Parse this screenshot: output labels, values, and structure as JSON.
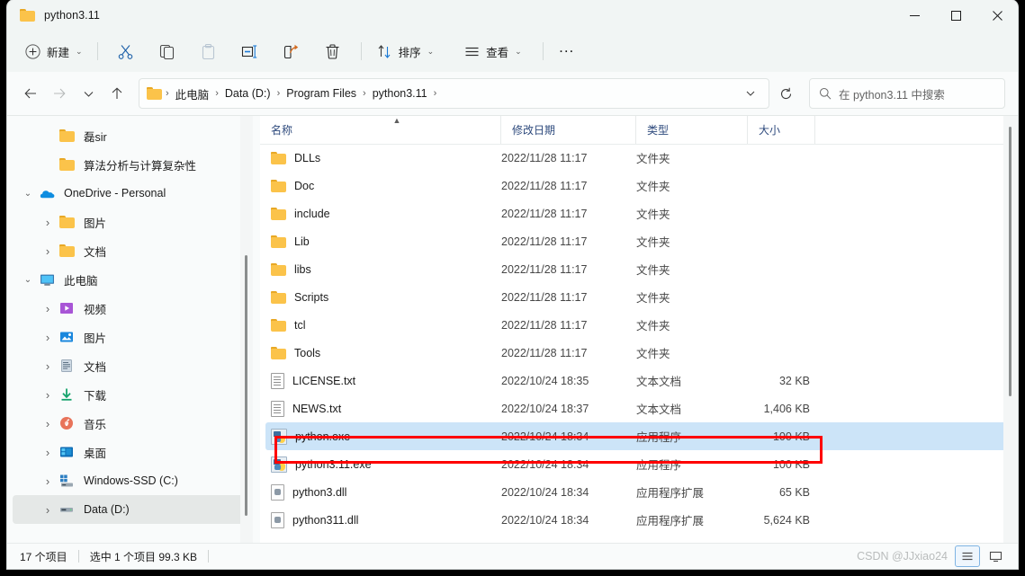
{
  "window": {
    "title": "python3.11",
    "minimize_label": "最小化",
    "maximize_label": "最大化",
    "close_label": "关闭"
  },
  "toolbar": {
    "new_label": "新建",
    "cut_label": "剪切",
    "copy_label": "复制",
    "paste_label": "粘贴",
    "rename_label": "重命名",
    "share_label": "共享",
    "delete_label": "删除",
    "sort_label": "排序",
    "view_label": "查看",
    "more_label": "..."
  },
  "address": {
    "back_label": "后退",
    "forward_label": "前进",
    "recent_label": "最近位置",
    "up_label": "上移到",
    "crumbs": [
      "此电脑",
      "Data (D:)",
      "Program Files",
      "python3.11"
    ],
    "separator": "›",
    "refresh_label": "刷新",
    "search_placeholder": "在 python3.11 中搜索"
  },
  "sidebar": {
    "items": [
      {
        "label": "磊sir",
        "icon": "folder",
        "expander": "none",
        "indent": 2
      },
      {
        "label": "算法分析与计算复杂性",
        "icon": "folder",
        "expander": "none",
        "indent": 2
      },
      {
        "label": "OneDrive - Personal",
        "icon": "onedrive",
        "expander": "expanded",
        "indent": 0
      },
      {
        "label": "图片",
        "icon": "folder",
        "expander": "collapsed",
        "indent": 1
      },
      {
        "label": "文档",
        "icon": "folder",
        "expander": "collapsed",
        "indent": 1
      },
      {
        "label": "此电脑",
        "icon": "pc",
        "expander": "expanded",
        "indent": 0
      },
      {
        "label": "视频",
        "icon": "video",
        "expander": "collapsed",
        "indent": 1
      },
      {
        "label": "图片",
        "icon": "pictures",
        "expander": "collapsed",
        "indent": 1
      },
      {
        "label": "文档",
        "icon": "documents",
        "expander": "collapsed",
        "indent": 1
      },
      {
        "label": "下载",
        "icon": "downloads",
        "expander": "collapsed",
        "indent": 1
      },
      {
        "label": "音乐",
        "icon": "music",
        "expander": "collapsed",
        "indent": 1
      },
      {
        "label": "桌面",
        "icon": "desktop",
        "expander": "collapsed",
        "indent": 1
      },
      {
        "label": "Windows-SSD (C:)",
        "icon": "sysdrive",
        "expander": "collapsed",
        "indent": 1
      },
      {
        "label": "Data (D:)",
        "icon": "drive",
        "expander": "collapsed",
        "indent": 1,
        "selected": true
      }
    ]
  },
  "filelist": {
    "columns": [
      {
        "key": "name",
        "label": "名称",
        "sorted": "asc"
      },
      {
        "key": "date",
        "label": "修改日期"
      },
      {
        "key": "type",
        "label": "类型"
      },
      {
        "key": "size",
        "label": "大小"
      }
    ],
    "rows": [
      {
        "name": "DLLs",
        "date": "2022/11/28 11:17",
        "type": "文件夹",
        "size": "",
        "icon": "folder"
      },
      {
        "name": "Doc",
        "date": "2022/11/28 11:17",
        "type": "文件夹",
        "size": "",
        "icon": "folder"
      },
      {
        "name": "include",
        "date": "2022/11/28 11:17",
        "type": "文件夹",
        "size": "",
        "icon": "folder"
      },
      {
        "name": "Lib",
        "date": "2022/11/28 11:17",
        "type": "文件夹",
        "size": "",
        "icon": "folder"
      },
      {
        "name": "libs",
        "date": "2022/11/28 11:17",
        "type": "文件夹",
        "size": "",
        "icon": "folder"
      },
      {
        "name": "Scripts",
        "date": "2022/11/28 11:17",
        "type": "文件夹",
        "size": "",
        "icon": "folder"
      },
      {
        "name": "tcl",
        "date": "2022/11/28 11:17",
        "type": "文件夹",
        "size": "",
        "icon": "folder"
      },
      {
        "name": "Tools",
        "date": "2022/11/28 11:17",
        "type": "文件夹",
        "size": "",
        "icon": "folder"
      },
      {
        "name": "LICENSE.txt",
        "date": "2022/10/24 18:35",
        "type": "文本文档",
        "size": "32 KB",
        "icon": "txt"
      },
      {
        "name": "NEWS.txt",
        "date": "2022/10/24 18:37",
        "type": "文本文档",
        "size": "1,406 KB",
        "icon": "txt"
      },
      {
        "name": "python.exe",
        "date": "2022/10/24 18:34",
        "type": "应用程序",
        "size": "100 KB",
        "icon": "exe",
        "selected": true,
        "highlighted": true
      },
      {
        "name": "python3.11.exe",
        "date": "2022/10/24 18:34",
        "type": "应用程序",
        "size": "100 KB",
        "icon": "exe"
      },
      {
        "name": "python3.dll",
        "date": "2022/10/24 18:34",
        "type": "应用程序扩展",
        "size": "65 KB",
        "icon": "dll"
      },
      {
        "name": "python311.dll",
        "date": "2022/10/24 18:34",
        "type": "应用程序扩展",
        "size": "5,624 KB",
        "icon": "dll"
      }
    ]
  },
  "status": {
    "item_count": "17 个项目",
    "selection": "选中 1 个项目  99.3 KB",
    "watermark": "CSDN @JJxiao24",
    "details_view_label": "详细信息",
    "large_icons_view_label": "大图标"
  },
  "colors": {
    "selection_blue": "#cce4f8",
    "annotation_red": "#ff0000",
    "header_text": "#2e4a7d",
    "folder_yellow": "#fbc34a",
    "accent_blue": "#0078d4"
  }
}
